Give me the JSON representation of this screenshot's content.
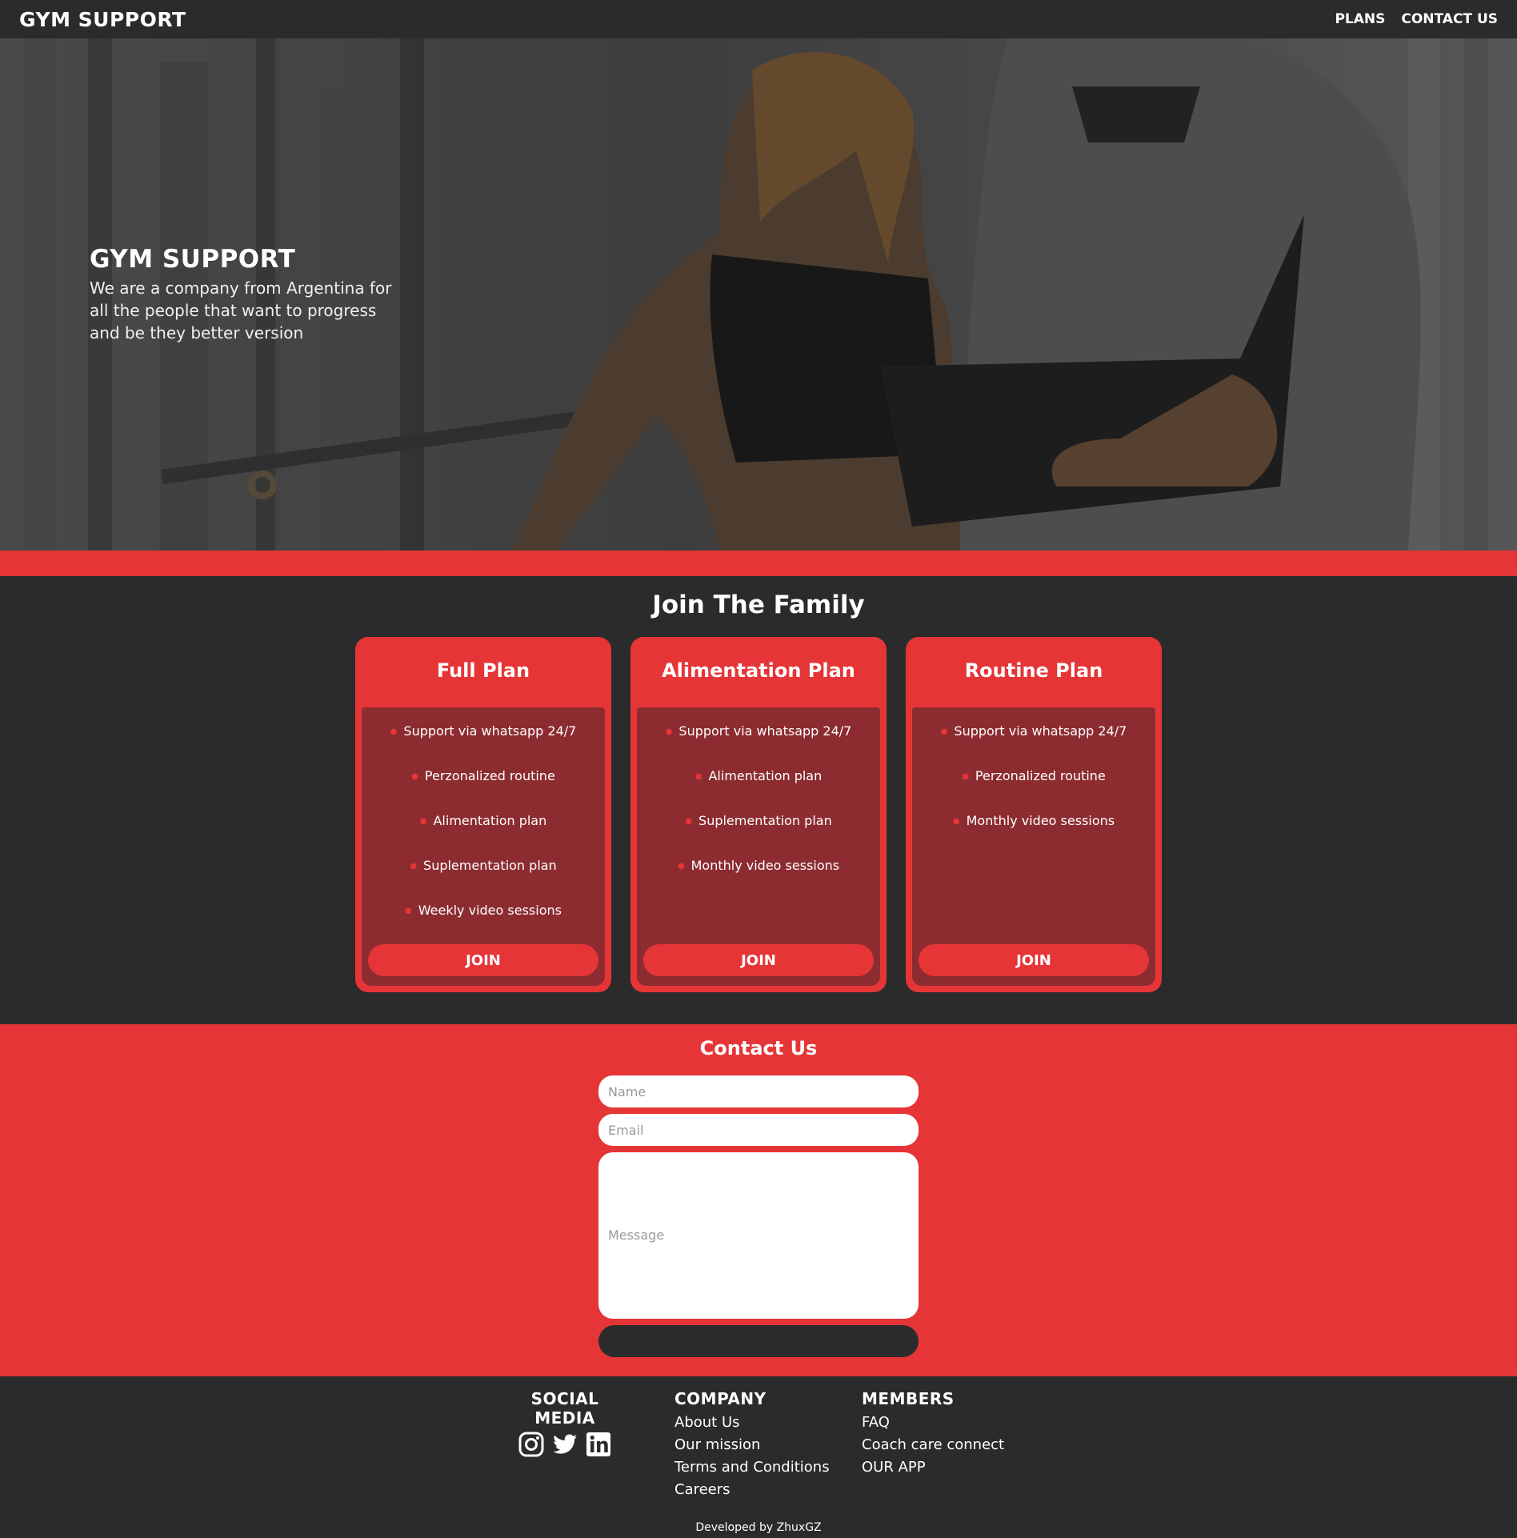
{
  "nav": {
    "brand": "GYM SUPPORT",
    "links": [
      "PLANS",
      "CONTACT US"
    ]
  },
  "hero": {
    "title": "GYM SUPPORT",
    "description": "We are a company from Argentina for all the people that want to progress and be they better version"
  },
  "plans": {
    "title": "Join The Family",
    "cards": [
      {
        "title": "Full Plan",
        "features": [
          "Support via whatsapp 24/7",
          "Perzonalized routine",
          "Alimentation plan",
          "Suplementation plan",
          "Weekly video sessions"
        ],
        "button": "JOIN"
      },
      {
        "title": "Alimentation Plan",
        "features": [
          "Support via whatsapp 24/7",
          "Alimentation plan",
          "Suplementation plan",
          "Monthly video sessions"
        ],
        "button": "JOIN"
      },
      {
        "title": "Routine Plan",
        "features": [
          "Support via whatsapp 24/7",
          "Perzonalized routine",
          "Monthly video sessions"
        ],
        "button": "JOIN"
      }
    ]
  },
  "contact": {
    "title": "Contact Us",
    "name_placeholder": "Name",
    "email_placeholder": "Email",
    "message_placeholder": "Message"
  },
  "footer": {
    "social": {
      "title": "SOCIAL MEDIA",
      "icons": [
        "instagram-icon",
        "twitter-icon",
        "linkedin-icon"
      ]
    },
    "company": {
      "title": "COMPANY",
      "links": [
        "About Us",
        "Our mission",
        "Terms and Conditions",
        "Careers"
      ]
    },
    "members": {
      "title": "MEMBERS",
      "links": [
        "FAQ",
        "Coach care connect",
        "OUR APP"
      ]
    },
    "credit": "Developed by ZhuxGZ"
  },
  "colors": {
    "accent": "#e63537",
    "dark": "#2b2b2b",
    "card_body": "#8c2c30"
  }
}
